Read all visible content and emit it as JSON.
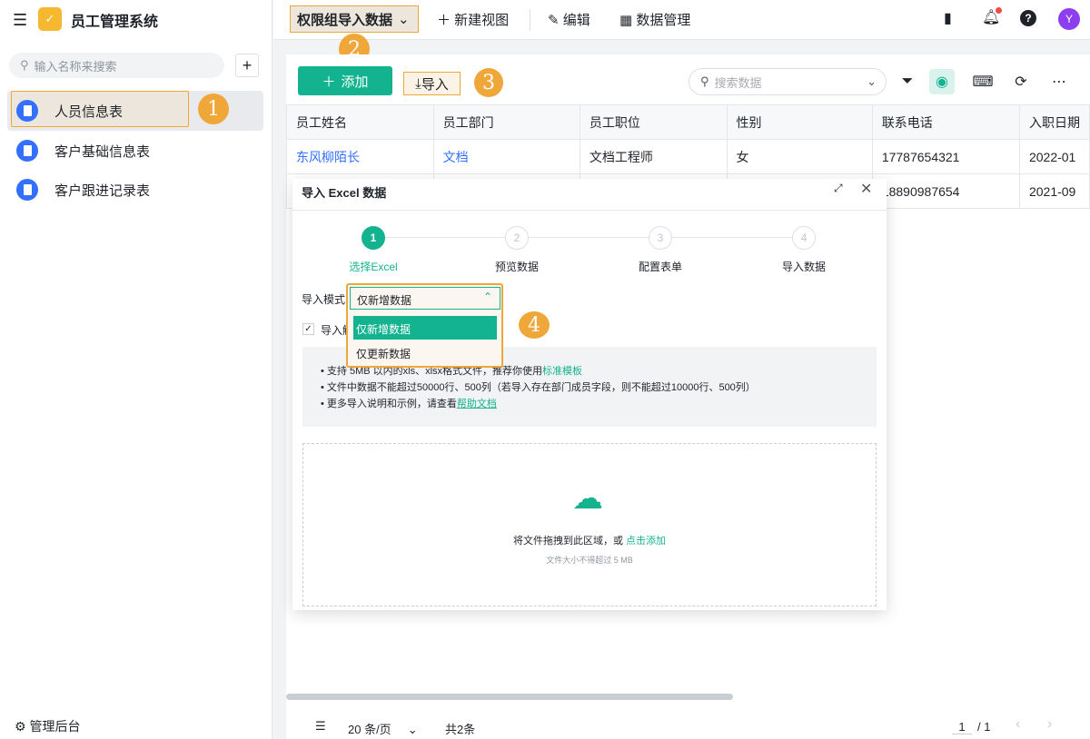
{
  "app": {
    "title": "员工管理系统"
  },
  "sidebar": {
    "search_placeholder": "输入名称来搜索",
    "items": [
      {
        "label": "人员信息表"
      },
      {
        "label": "客户基础信息表"
      },
      {
        "label": "客户跟进记录表"
      }
    ],
    "footer": "管理后台"
  },
  "topbar": {
    "view": "权限组导入数据",
    "new_view": "新建视图",
    "edit": "编辑",
    "data_manage": "数据管理",
    "avatar": "Y"
  },
  "toolbar": {
    "add": "添加",
    "import": "导入",
    "search_placeholder": "搜索数据"
  },
  "annotations": [
    "1",
    "2",
    "3",
    "4"
  ],
  "table": {
    "headers": [
      "员工姓名",
      "员工部门",
      "员工职位",
      "性别",
      "联系电话",
      "入职日期"
    ],
    "rows": [
      [
        "东风柳陌长",
        "文档",
        "文档工程师",
        "女",
        "17787654321",
        "2022-01"
      ],
      [
        "",
        "",
        "",
        "",
        "18890987654",
        "2021-09"
      ]
    ]
  },
  "modal": {
    "title": "导入 Excel 数据",
    "steps": [
      {
        "n": "1",
        "label": "选择Excel"
      },
      {
        "n": "2",
        "label": "预览数据"
      },
      {
        "n": "3",
        "label": "配置表单"
      },
      {
        "n": "4",
        "label": "导入数据"
      }
    ],
    "mode_label": "导入模式",
    "mode_value": "仅新增数据",
    "options": [
      "仅新增数据",
      "仅更新数据"
    ],
    "checkbox_label": "导入触",
    "tips": [
      {
        "text": "支持 5MB 以内的xls、xlsx格式文件，推荐你使用",
        "link": "标准模板"
      },
      {
        "text": "文件中数据不能超过50000行、500列（若导入存在部门成员字段，则不能超过10000行、500列）",
        "link": ""
      },
      {
        "text": "更多导入说明和示例，请查看",
        "link": "帮助文档"
      }
    ],
    "drop_text": "将文件拖拽到此区域，或 ",
    "drop_link": "点击添加",
    "drop_hint": "文件大小不得超过 5 MB"
  },
  "pagination": {
    "page_size": "20 条/页",
    "total": "共2条",
    "page": "1",
    "pages": "/ 1"
  }
}
